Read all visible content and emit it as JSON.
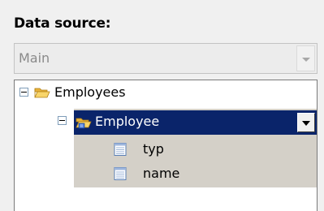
{
  "panel": {
    "data_source_label": "Data source:",
    "data_source_value": "Main"
  },
  "tree": {
    "root": {
      "label": "Employees",
      "icon": "folder-open-icon",
      "expanded": true,
      "children": [
        {
          "label": "Employee",
          "icon": "repeating-folder-icon",
          "expanded": true,
          "selected": true,
          "children": [
            {
              "label": "typ",
              "icon": "field-icon"
            },
            {
              "label": "name",
              "icon": "field-icon"
            }
          ]
        }
      ]
    }
  },
  "colors": {
    "selection": "#0a246a",
    "group_background": "#d4d0c8",
    "folder": "#f5c242"
  }
}
